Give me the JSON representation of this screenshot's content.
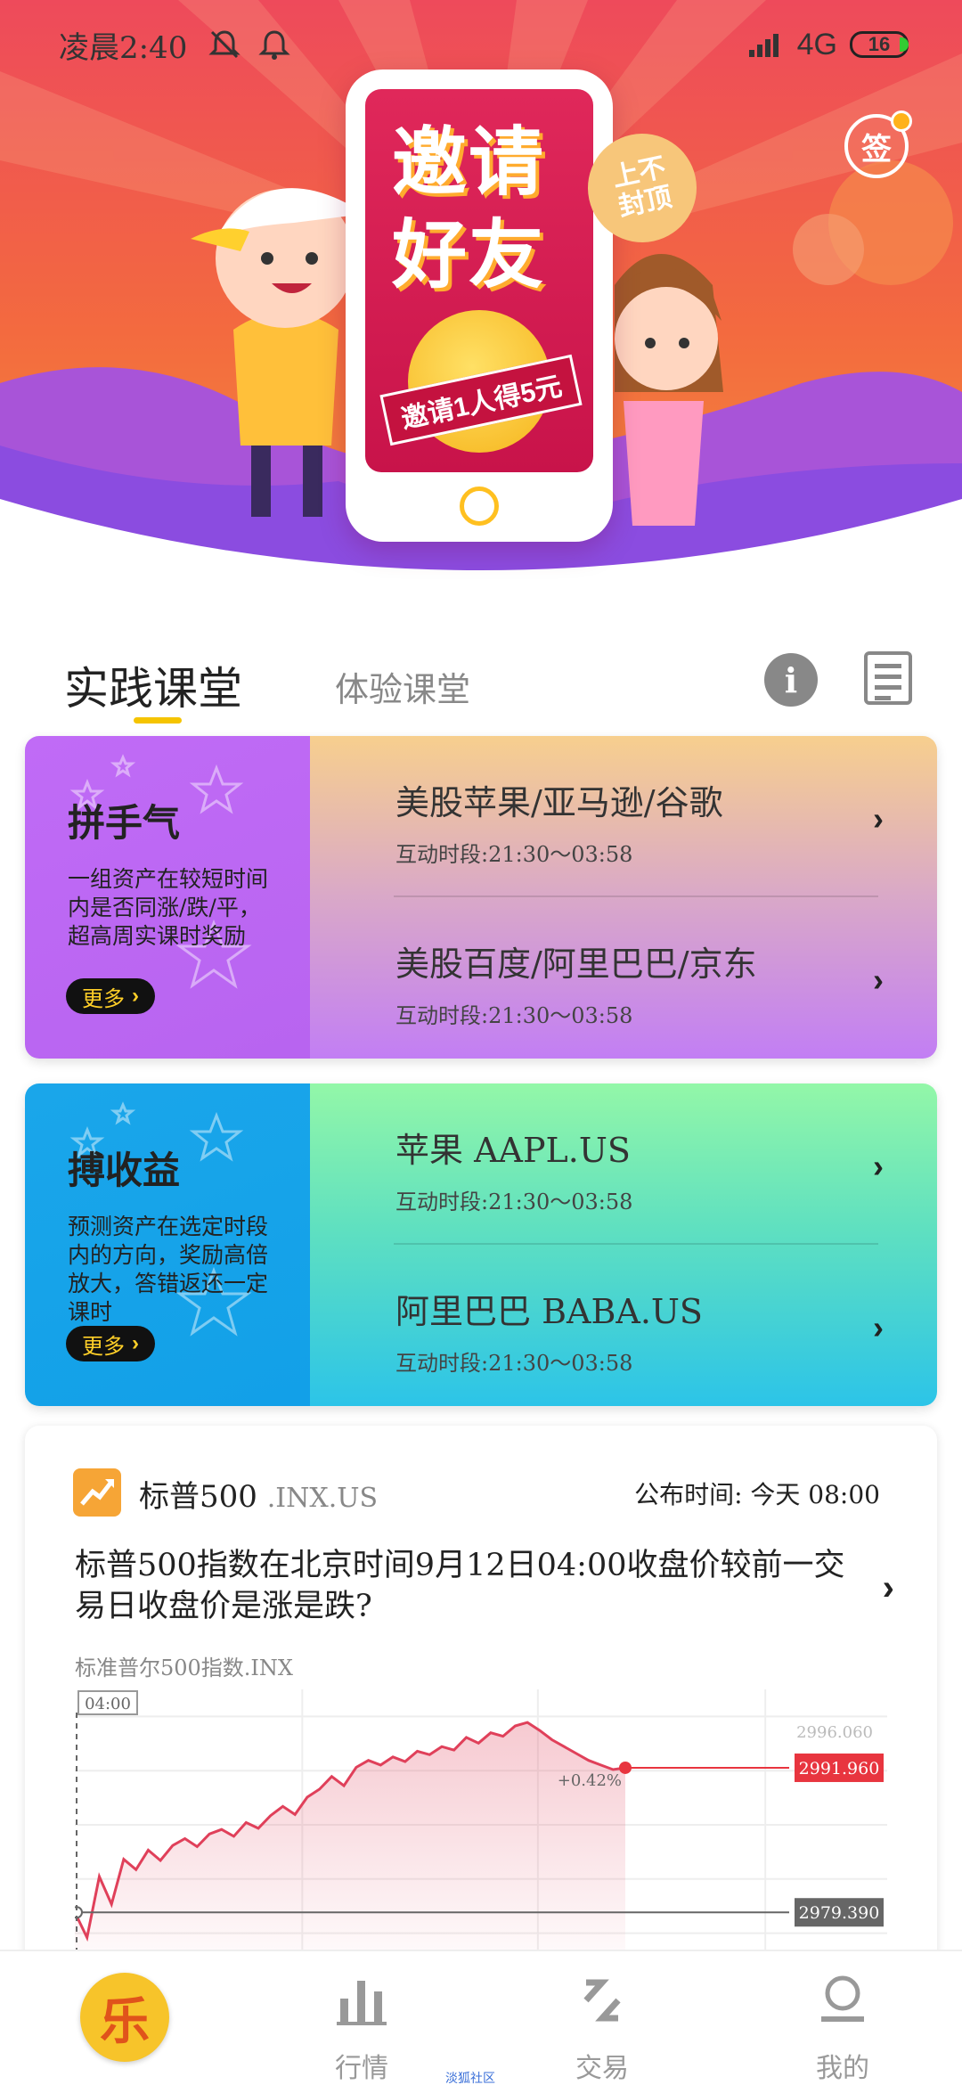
{
  "status_bar": {
    "time": "凌晨2:40",
    "network": "4G",
    "battery": "16"
  },
  "banner": {
    "title_line1": "邀请",
    "title_line2": "好友",
    "bubble": "上不\n封顶",
    "ribbon": "邀请1人得5元",
    "sign_label": "签"
  },
  "section_tabs": {
    "active": "实践课堂",
    "inactive": "体验课堂"
  },
  "cards": [
    {
      "title": "拼手气",
      "desc": "一组资产在较短时间内是否同涨/跌/平，超高周实课时奖励",
      "more": "更多",
      "rows": [
        {
          "title": "美股苹果/亚马逊/谷歌",
          "sub": "互动时段:21:30～03:58"
        },
        {
          "title": "美股百度/阿里巴巴/京东",
          "sub": "互动时段:21:30～03:58"
        }
      ]
    },
    {
      "title": "搏收益",
      "desc": "预测资产在选定时段内的方向，奖励高倍放大，答错返还一定课时",
      "more": "更多",
      "rows": [
        {
          "title": "苹果 AAPL.US",
          "sub": "互动时段:21:30～03:58"
        },
        {
          "title": "阿里巴巴 BABA.US",
          "sub": "互动时段:21:30～03:58"
        }
      ]
    }
  ],
  "index_card": {
    "name": "标普500",
    "code": ".INX.US",
    "publish_time": "公布时间: 今天 08:00",
    "question": "标普500指数在北京时间9月12日04:00收盘价较前一交易日收盘价是涨是跌?",
    "subtitle": "标准普尔500指数.INX",
    "colors": {
      "line": "#e0405a",
      "target": "#e8353f",
      "base": "#666666"
    }
  },
  "chart_data": {
    "type": "line",
    "start_label": "04:00",
    "change_label": "+0.42%",
    "y_ticks": [
      "2996.060",
      "2979.390"
    ],
    "target_value_label": "2991.960",
    "base_value_label": "2979.390",
    "target_value": 2991.96,
    "base_value": 2979.39,
    "ylim": [
      2976.0,
      2998.0
    ],
    "values": [
      2979.4,
      2977.2,
      2982.5,
      2980.1,
      2984.0,
      2983.1,
      2984.8,
      2983.9,
      2985.2,
      2985.8,
      2985.1,
      2986.2,
      2986.6,
      2986.0,
      2987.2,
      2986.7,
      2987.8,
      2988.6,
      2987.9,
      2989.4,
      2990.1,
      2991.2,
      2990.4,
      2992.0,
      2992.6,
      2992.2,
      2992.9,
      2992.5,
      2993.4,
      2993.1,
      2993.8,
      2993.5,
      2994.6,
      2994.1,
      2995.0,
      2994.7,
      2995.6,
      2995.9,
      2995.2,
      2994.4,
      2993.8,
      2993.2,
      2992.6,
      2992.2,
      2991.8,
      2991.96
    ]
  },
  "bottom_nav": {
    "home": "乐",
    "items": [
      {
        "label": "行情",
        "icon": "bar-chart-icon"
      },
      {
        "label": "交易",
        "icon": "trade-icon"
      },
      {
        "label": "我的",
        "icon": "user-icon"
      }
    ],
    "watermark": "淡狐社区"
  }
}
